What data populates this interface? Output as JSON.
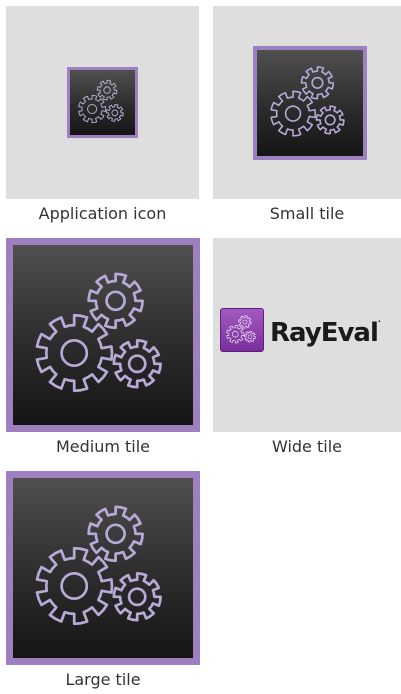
{
  "tiles": [
    {
      "caption": "Application icon"
    },
    {
      "caption": "Small tile"
    },
    {
      "caption": "Medium tile"
    },
    {
      "caption": "Wide tile"
    },
    {
      "caption": "Large tile"
    }
  ],
  "wide_tile": {
    "brand_name": "RayEval",
    "trademark": "·"
  },
  "colors": {
    "cell_background": "#dedede",
    "tile_border": "#9e80c0",
    "gear_stroke": "#b8a9d6",
    "logo_purple": "#8a3aaa"
  },
  "icons": [
    "gears-icon"
  ]
}
